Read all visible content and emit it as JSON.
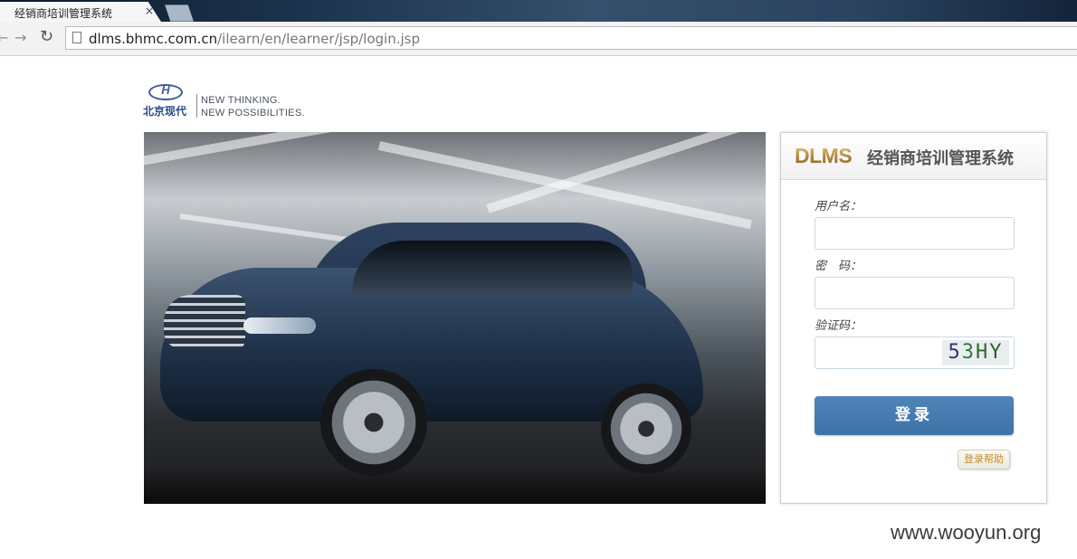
{
  "browser": {
    "tab_title": "经销商培训管理系统",
    "tab_close": "×",
    "url_host": "dlms.bhmc.com.cn",
    "url_path": "/ilearn/en/learner/jsp/login.jsp"
  },
  "brand": {
    "name_cn": "北京现代",
    "tagline_line1": "NEW THINKING.",
    "tagline_line2": "NEW POSSIBILITIES."
  },
  "login": {
    "logo_text": "DLMS",
    "system_title": "经销商培训管理系统",
    "username_label": "用户名：",
    "password_label": "密　码：",
    "captcha_label": "验证码：",
    "captcha_chars": [
      "5",
      "3",
      "H",
      "Y"
    ],
    "submit_label": "登录",
    "help_label": "登录帮助"
  },
  "watermark": "www.wooyun.org",
  "colors": {
    "button": "#4279ae",
    "help_text": "#c38a2a",
    "logo_gold": "#c9a45e"
  }
}
